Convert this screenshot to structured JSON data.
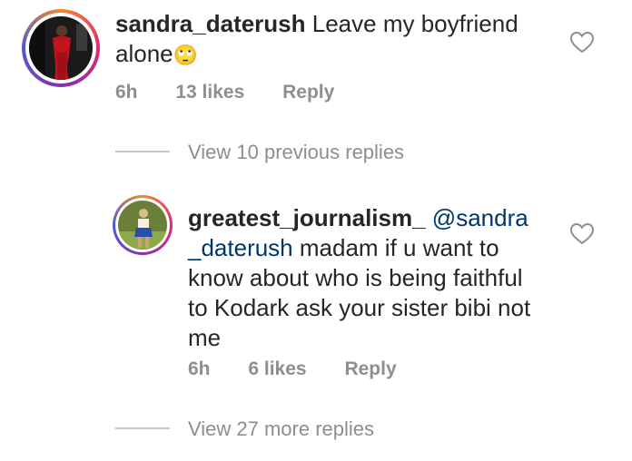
{
  "comment": {
    "username": "sandra_daterush",
    "text": "Leave my boyfriend alone",
    "emoji": "🙄",
    "time": "6h",
    "likes": "13 likes",
    "reply_label": "Reply"
  },
  "view_previous": "View 10 previous replies",
  "reply": {
    "username": "greatest_journalism_",
    "mention": "@sandra_daterush",
    "mention_line1": "@sandra",
    "mention_line2": "_daterush",
    "line2_rest": " madam if u want to",
    "line3": "know about who is being faithful",
    "line4": "to Kodark ask your sister bibi not",
    "line5": "me",
    "time": "6h",
    "likes": "6 likes",
    "reply_label": "Reply"
  },
  "view_more": "View 27 more replies",
  "colors": {
    "text": "#262626",
    "meta": "#8e8e8e",
    "mention": "#00376b",
    "divider": "#c7c7c7"
  }
}
